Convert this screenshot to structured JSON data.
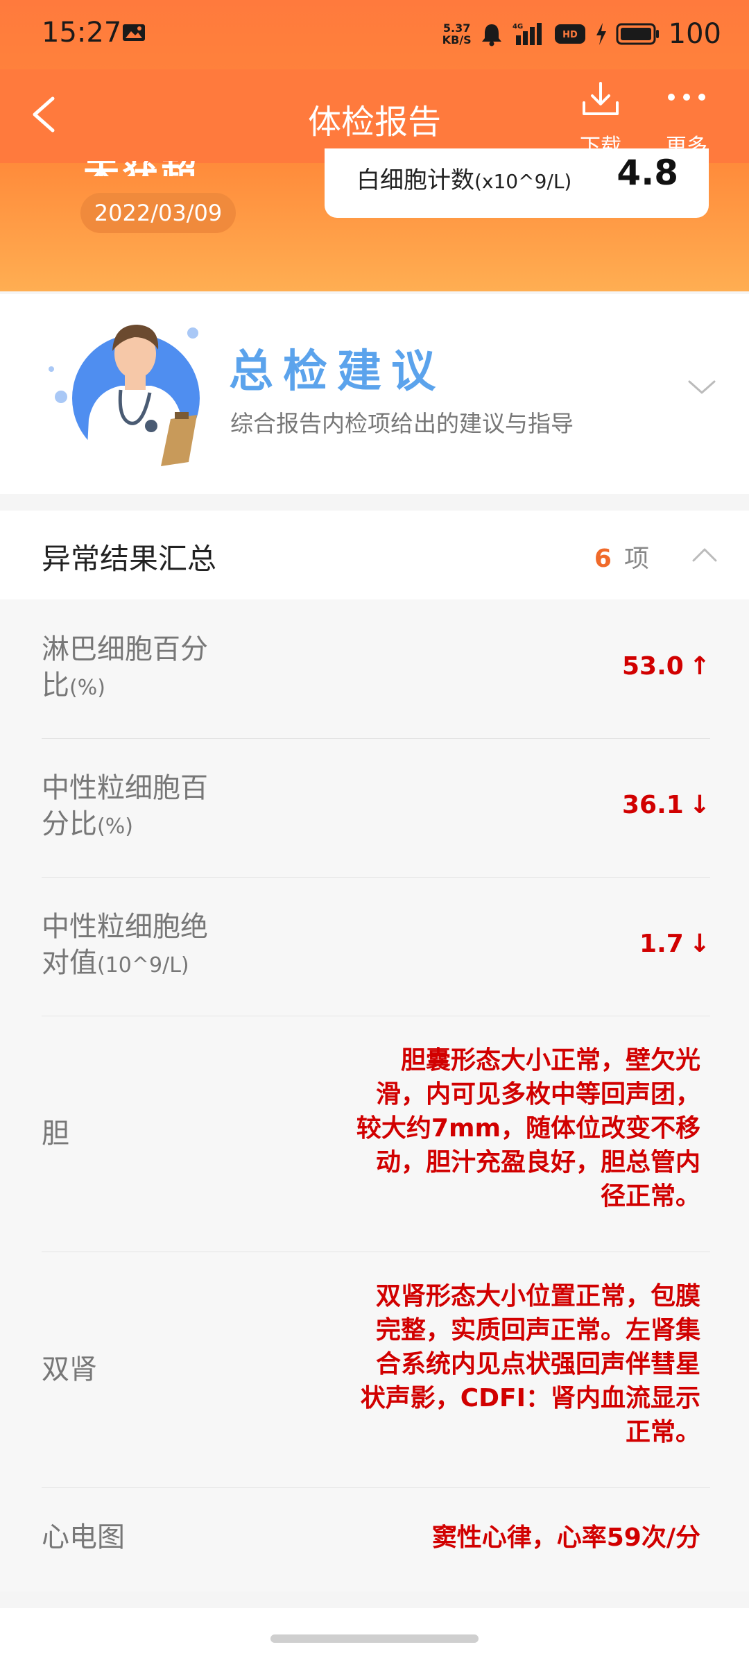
{
  "status_bar": {
    "time": "15:27",
    "net_speed_value": "5.37",
    "net_speed_unit": "KB/S",
    "signal": "4G",
    "hd": "HD",
    "battery": "100"
  },
  "app_bar": {
    "title": "体检报告",
    "download_label": "下载",
    "more_label": "更多"
  },
  "header_card": {
    "partial_title": "未获超",
    "date": "2022/03/09",
    "wbc_label": "白细胞计数",
    "wbc_unit": "(x10^9/L)",
    "wbc_value": "4.8"
  },
  "advice": {
    "title": "总检建议",
    "subtitle": "综合报告内检项给出的建议与指导"
  },
  "abnormal": {
    "title": "异常结果汇总",
    "count": "6",
    "count_unit": "项",
    "rows": [
      {
        "name_line1": "淋巴细胞百分",
        "name_line2": "比",
        "unit": "(%)",
        "value": "53.0",
        "arrow": "↑"
      },
      {
        "name_line1": "中性粒细胞百",
        "name_line2": "分比",
        "unit": "(%)",
        "value": "36.1",
        "arrow": "↓"
      },
      {
        "name_line1": "中性粒细胞绝",
        "name_line2": "对值",
        "unit": "(10^9/L)",
        "value": "1.7",
        "arrow": "↓"
      },
      {
        "name": "胆",
        "value_lines": [
          "胆囊形态大小正常，壁欠光",
          "滑，内可见多枚中等回声团，",
          "较大约7mm，随体位改变不移",
          "动，胆汁充盈良好，胆总管内",
          "径正常。"
        ]
      },
      {
        "name": "双肾",
        "value_lines": [
          "双肾形态大小位置正常，包膜",
          "完整，实质回声正常。左肾集",
          "合系统内见点状强回声伴彗星",
          "状声影，CDFI：肾内血流显示",
          "正常。"
        ]
      },
      {
        "name": "心电图",
        "value": "窦性心律，心率59次/分"
      }
    ]
  },
  "colors": {
    "accent_orange": "#ff7a3d",
    "abnormal_red": "#d10000",
    "advice_blue": "#5ba3ec"
  }
}
